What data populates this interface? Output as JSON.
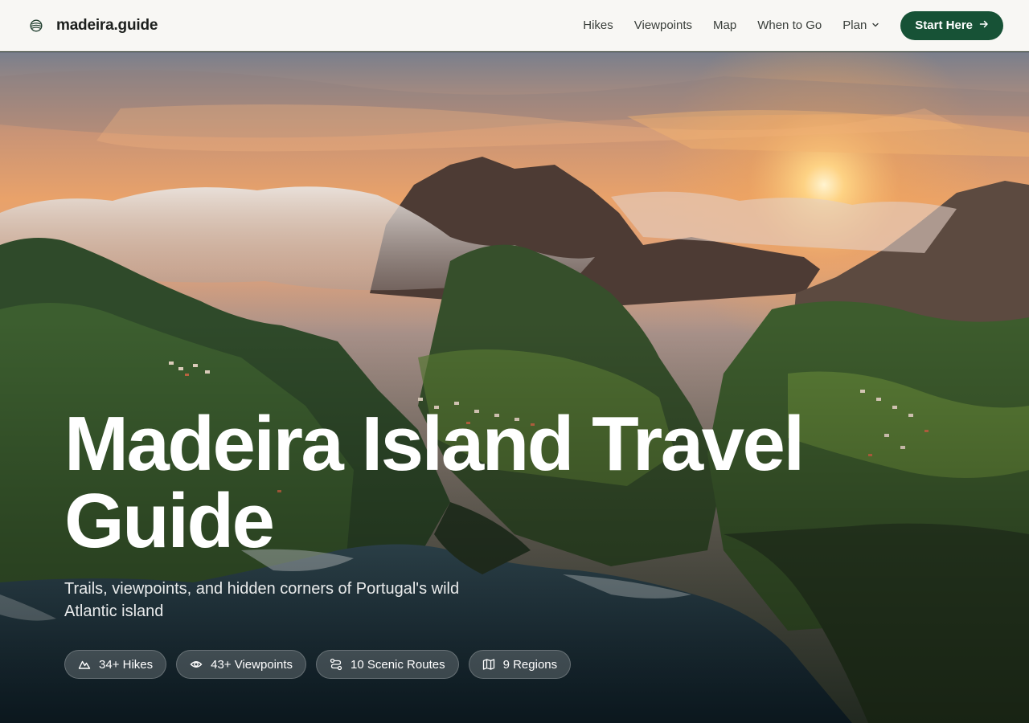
{
  "header": {
    "brand_icon": "globe-icon",
    "brand_name": "madeira.guide",
    "nav": [
      {
        "label": "Hikes"
      },
      {
        "label": "Viewpoints"
      },
      {
        "label": "Map"
      },
      {
        "label": "When to Go"
      },
      {
        "label": "Plan",
        "icon": "chevron-down-icon"
      }
    ],
    "cta": {
      "label": "Start Here",
      "icon": "arrow-right-icon"
    }
  },
  "hero": {
    "title": "Madeira Island Travel Guide",
    "subtitle": "Trails, viewpoints, and hidden corners of Portugal's wild Atlantic island",
    "stats": [
      {
        "icon": "mountain-icon",
        "label": "34+ Hikes"
      },
      {
        "icon": "eye-icon",
        "label": "43+ Viewpoints"
      },
      {
        "icon": "route-icon",
        "label": "10 Scenic Routes"
      },
      {
        "icon": "map-icon",
        "label": "9 Regions"
      }
    ]
  },
  "colors": {
    "accent": "#175236",
    "header_bg": "#f8f7f4"
  }
}
